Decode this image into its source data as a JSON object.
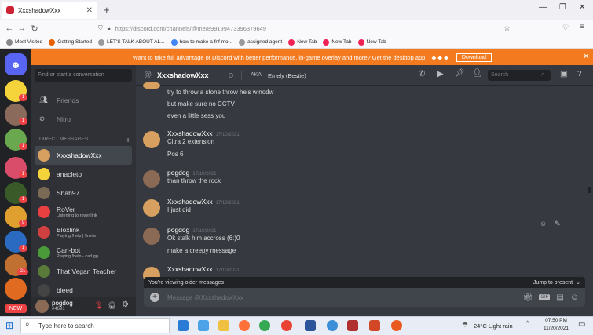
{
  "browser": {
    "tab_title": "XxxshadowXxx",
    "url": "https://discord.com/channels/@me/899199473396379649",
    "bookmarks": [
      "Most Visited",
      "Getting Started",
      "LET'S TALK ABOUT AL...",
      "how to make a fnf mo...",
      "assigned agent",
      "New Tab",
      "New Tab",
      "New Tab"
    ]
  },
  "banner": {
    "text": "Want to take full advantage of Discord with better performance, in-game overlay and more? Get the desktop app!",
    "button": "Download"
  },
  "guild_badges": [
    "1",
    "1",
    "1",
    "1",
    "1",
    "1",
    "9",
    "1",
    "21"
  ],
  "guild_new": "NEW",
  "sidebar": {
    "search_placeholder": "Find or start a conversation",
    "friends": "Friends",
    "nitro": "Nitro",
    "dm_header": "DIRECT MESSAGES",
    "add": "+",
    "dms": [
      {
        "name": "XxxshadowXxx",
        "status": "",
        "color": "#d8a060"
      },
      {
        "name": "anacleto",
        "status": "",
        "color": "#f5d33a"
      },
      {
        "name": "Shah97",
        "status": "",
        "color": "#7a6a55"
      },
      {
        "name": "RoVer",
        "status": "Listening to rover.link",
        "color": "#e84040"
      },
      {
        "name": "Bloxlink",
        "status": "Playing !help | !invite",
        "color": "#d04040"
      },
      {
        "name": "Carl-bot",
        "status": "Playing !help - carl.gg",
        "color": "#4a9a3a"
      },
      {
        "name": "That Vegan Teacher",
        "status": "",
        "color": "#5a7a3a"
      },
      {
        "name": "bleed",
        "status": "",
        "color": "#444"
      }
    ],
    "user": {
      "name": "pogdog",
      "tag": "#4691"
    }
  },
  "topbar": {
    "channel": "XxxshadowXxx",
    "aka": "AKA",
    "nickname": "Emely (Bestie)",
    "search": "Search"
  },
  "messages": [
    {
      "lines": [
        "try to throw a stone throw he's winodw",
        "but make sure no CCTV",
        "even a little sess you"
      ]
    },
    {
      "author": "XxxshadowXxx",
      "time": "17/10/2021",
      "lines": [
        "Citra 2 extension",
        "Pos 6"
      ]
    },
    {
      "author": "pogdog",
      "time": "17/10/2021",
      "lines": [
        "than throw the rock"
      ]
    },
    {
      "author": "XxxshadowXxx",
      "time": "17/10/2021",
      "lines": [
        "I just did"
      ]
    },
    {
      "author": "pogdog",
      "time": "17/10/2021",
      "lines": [
        "Ok stalk him accross (6:)0",
        "make a creepy message"
      ]
    },
    {
      "author": "XxxshadowXxx",
      "time": "17/10/2021",
      "lines": []
    }
  ],
  "older": {
    "text": "You're viewing older messages",
    "jump": "Jump to present"
  },
  "input": {
    "placeholder": "Message @XxxshadowXxx"
  },
  "taskbar": {
    "search": "Type here to search",
    "weather": "24°C  Light rain",
    "time": "07:50 PM",
    "date": "11/20/2021"
  }
}
